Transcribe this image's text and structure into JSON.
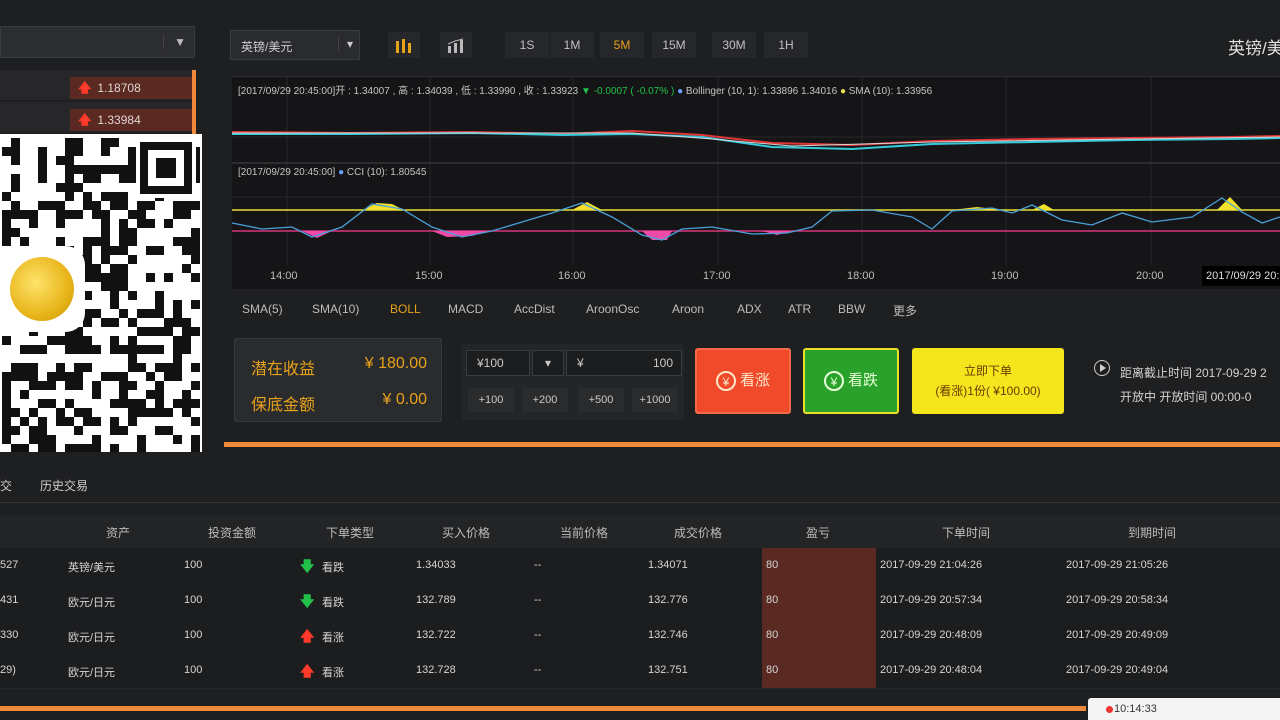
{
  "left": {
    "tickers": [
      {
        "value": "1.18708",
        "direction": "up"
      },
      {
        "value": "1.33984",
        "direction": "up"
      }
    ]
  },
  "toolbar": {
    "pair": "英镑/美元",
    "timeframes": [
      "1S",
      "1M",
      "5M",
      "15M",
      "30M",
      "1H"
    ],
    "active_timeframe": "5M",
    "right_title": "英镑/美"
  },
  "chart": {
    "legend_main": "[2017/09/29 20:45:00]开 : 1.34007 , 高 : 1.34039 , 低 : 1.33990 , 收 : 1.33923",
    "legend_change": "▼ -0.0007 ( -0.07% )",
    "legend_boll": "Bollinger (10, 1): 1.33896",
    "legend_boll2": "1.34016",
    "legend_sma": "SMA (10): 1.33956",
    "legend_cci": "[2017/09/29 20:45:00]",
    "legend_cci_val": "CCI (10): 1.80545",
    "x_ticks": [
      "14:00",
      "15:00",
      "16:00",
      "17:00",
      "18:00",
      "19:00",
      "20:00"
    ],
    "cursor_label": "2017/09/29 20:"
  },
  "indicators": [
    "SMA(5)",
    "SMA(10)",
    "BOLL",
    "MACD",
    "AccDist",
    "AroonOsc",
    "Aroon",
    "ADX",
    "ATR",
    "BBW",
    "更多"
  ],
  "active_indicator": "BOLL",
  "earnings": {
    "potential_label": "潜在收益",
    "potential_value": "¥ 180.00",
    "guaranteed_label": "保底金额",
    "guaranteed_value": "¥ 0.00"
  },
  "amount": {
    "preset": "¥100",
    "currency": "¥",
    "value": "100",
    "quick": [
      "+100",
      "+200",
      "+500",
      "+1000"
    ]
  },
  "buttons": {
    "up_label": "看涨",
    "down_label": "看跌",
    "order_line1": "立即下单",
    "order_line2": "(看涨)1份( ¥100.00)"
  },
  "time_info": {
    "line1": "距离截止时间 2017-09-29 2",
    "line2": "开放中  开放时间 00:00-0"
  },
  "tabs": [
    "交",
    "历史交易"
  ],
  "table": {
    "headers": [
      "资产",
      "投资金额",
      "下单类型",
      "买入价格",
      "当前价格",
      "成交价格",
      "盈亏",
      "下单时间",
      "到期时间"
    ],
    "rows": [
      {
        "id": "527",
        "asset": "英镑/美元",
        "amount": "100",
        "type": "看跌",
        "dir": "down",
        "buy": "1.34033",
        "current": "--",
        "deal": "1.34071",
        "profit": "80",
        "order_time": "2017-09-29 21:04:26",
        "expire": "2017-09-29 21:05:26"
      },
      {
        "id": "431",
        "asset": "欧元/日元",
        "amount": "100",
        "type": "看跌",
        "dir": "down",
        "buy": "132.789",
        "current": "--",
        "deal": "132.776",
        "profit": "80",
        "order_time": "2017-09-29 20:57:34",
        "expire": "2017-09-29 20:58:34"
      },
      {
        "id": "330",
        "asset": "欧元/日元",
        "amount": "100",
        "type": "看涨",
        "dir": "up",
        "buy": "132.722",
        "current": "--",
        "deal": "132.746",
        "profit": "80",
        "order_time": "2017-09-29 20:48:09",
        "expire": "2017-09-29 20:49:09"
      },
      {
        "id": "29)",
        "asset": "欧元/日元",
        "amount": "100",
        "type": "看涨",
        "dir": "up",
        "buy": "132.728",
        "current": "--",
        "deal": "132.751",
        "profit": "80",
        "order_time": "2017-09-29 20:48:04",
        "expire": "2017-09-29 20:49:04"
      }
    ]
  },
  "status": {
    "time": "10:14:33"
  }
}
